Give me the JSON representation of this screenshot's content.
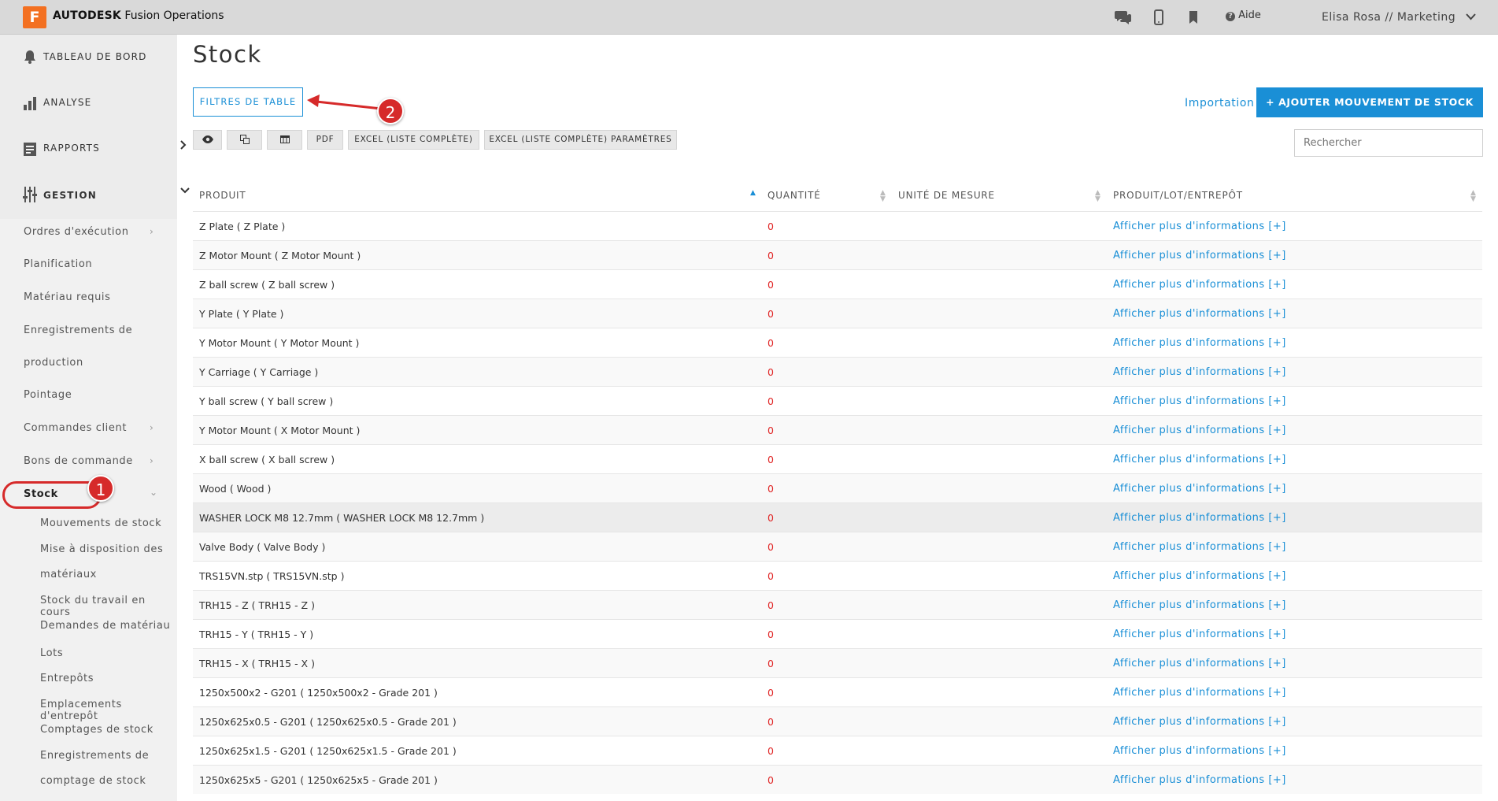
{
  "app": {
    "logo_letter": "F",
    "brand_bold": "AUTODESK",
    "brand_rest": " Fusion Operations"
  },
  "topbar": {
    "aide": "Aide",
    "user": "Elisa Rosa // Marketing"
  },
  "sidebar": {
    "top": [
      {
        "label": "TABLEAU DE BORD"
      },
      {
        "label": "ANALYSE"
      },
      {
        "label": "RAPPORTS"
      },
      {
        "label": "GESTION"
      }
    ],
    "items": [
      "Ordres d'exécution",
      "Planification",
      "Matériau requis",
      "Enregistrements de",
      "production",
      "Pointage",
      "Commandes client",
      "Bons de commande",
      "Stock"
    ],
    "stock_sub": [
      "Mouvements de stock",
      "Mise à disposition des",
      "matériaux",
      "Stock du travail en cours",
      "Demandes de matériau",
      "Lots",
      "Entrepôts",
      "Emplacements d'entrepôt",
      "Comptages de stock",
      "Enregistrements de",
      "comptage de stock"
    ]
  },
  "main": {
    "title": "Stock",
    "filter_button": "FILTRES DE TABLE",
    "import_link": "Importation",
    "add_button": "+ AJOUTER MOUVEMENT DE STOCK",
    "tools": [
      "PDF",
      "EXCEL (LISTE COMPLÈTE)",
      "EXCEL (LISTE COMPLÈTE) PARAMÈTRES"
    ],
    "search_placeholder": "Rechercher"
  },
  "table": {
    "headers": [
      "PRODUIT",
      "QUANTITÉ",
      "UNITÉ DE MESURE",
      "PRODUIT/LOT/ENTREPÔT"
    ],
    "link_text": "Afficher plus d'informations [+]",
    "rows": [
      {
        "product": "Z Plate ( Z Plate )",
        "qty": "0"
      },
      {
        "product": "Z Motor Mount ( Z Motor Mount )",
        "qty": "0"
      },
      {
        "product": "Z ball screw ( Z ball screw )",
        "qty": "0"
      },
      {
        "product": "Y Plate ( Y Plate )",
        "qty": "0"
      },
      {
        "product": "Y Motor Mount ( Y Motor Mount )",
        "qty": "0"
      },
      {
        "product": "Y Carriage ( Y Carriage )",
        "qty": "0"
      },
      {
        "product": "Y ball screw ( Y ball screw )",
        "qty": "0"
      },
      {
        "product": "Y Motor Mount ( X Motor Mount )",
        "qty": "0"
      },
      {
        "product": "X ball screw ( X ball screw )",
        "qty": "0"
      },
      {
        "product": "Wood ( Wood )",
        "qty": "0"
      },
      {
        "product": "WASHER LOCK M8 12.7mm ( WASHER LOCK M8 12.7mm )",
        "qty": "0"
      },
      {
        "product": "Valve Body ( Valve Body )",
        "qty": "0"
      },
      {
        "product": "TRS15VN.stp ( TRS15VN.stp )",
        "qty": "0"
      },
      {
        "product": "TRH15 - Z ( TRH15 - Z )",
        "qty": "0"
      },
      {
        "product": "TRH15 - Y ( TRH15 - Y )",
        "qty": "0"
      },
      {
        "product": "TRH15 - X ( TRH15 - X )",
        "qty": "0"
      },
      {
        "product": "1250x500x2 - G201 ( 1250x500x2 - Grade 201 )",
        "qty": "0"
      },
      {
        "product": "1250x625x0.5 - G201 ( 1250x625x0.5 - Grade 201 )",
        "qty": "0"
      },
      {
        "product": "1250x625x1.5 - G201 ( 1250x625x1.5 - Grade 201 )",
        "qty": "0"
      },
      {
        "product": "1250x625x5 - G201 ( 1250x625x5 - Grade 201 )",
        "qty": "0"
      }
    ]
  },
  "annotations": {
    "one": "1",
    "two": "2"
  },
  "colors": {
    "accent": "#1a8fd6",
    "zero": "#e02424",
    "annotation": "#d62a2a",
    "logo": "#f37021"
  }
}
